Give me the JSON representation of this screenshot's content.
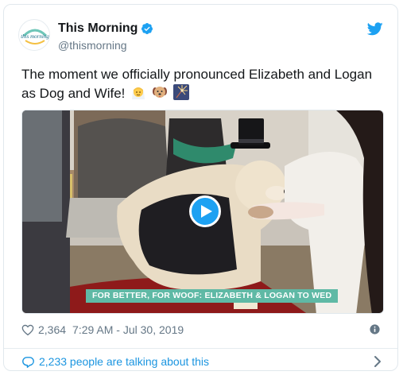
{
  "tweet": {
    "author_name": "This Morning",
    "author_handle": "@thismorning",
    "avatar_logo_text": "this morning",
    "text": "The moment we officially pronounced Elizabeth and Logan as Dog and Wife!",
    "emojis": [
      "bride-with-veil-emoji",
      "dog-face-emoji",
      "sparkler-emoji"
    ],
    "media": {
      "type": "video",
      "caption": "FOR BETTER, FOR WOOF: ELIZABETH & LOGAN TO WED"
    },
    "likes": "2,364",
    "time": "7:29 AM - Jul 30, 2019",
    "talking": "2,233 people are talking about this"
  },
  "colors": {
    "twitter_blue": "#1da1f2",
    "link_blue": "#1b95e0",
    "meta_gray": "#657786",
    "caption_bar": "#5fb9a5"
  },
  "icons": [
    "verified-badge-icon",
    "twitter-bird-icon",
    "heart-icon",
    "info-icon",
    "comment-bubble-icon",
    "chevron-right-icon",
    "play-icon"
  ]
}
